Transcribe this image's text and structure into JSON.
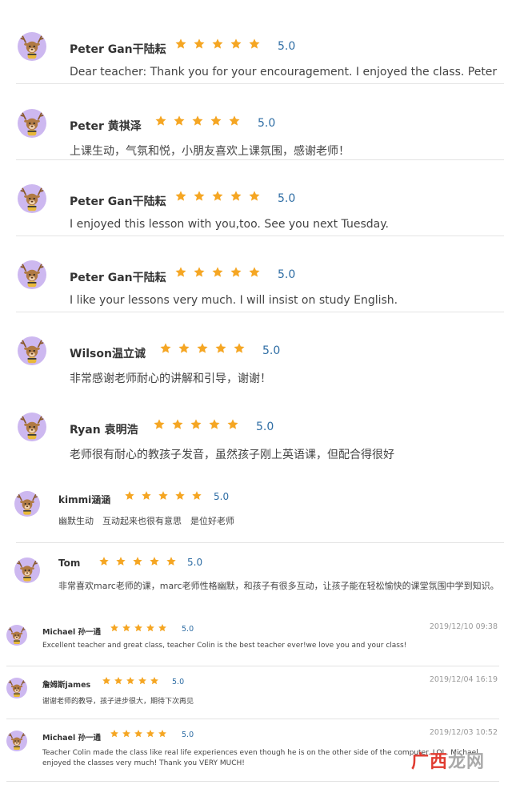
{
  "reviews": [
    {
      "name": "Peter Gan干陆耘",
      "score": "5.0",
      "rating": 5,
      "text": "Dear teacher: Thank you for your encouragement. I enjoyed the class. Peter"
    },
    {
      "name": "Peter 黄祺泽",
      "score": "5.0",
      "rating": 5,
      "text": "上课生动，气氛和悦，小朋友喜欢上课氛围，感谢老师！"
    },
    {
      "name": "Peter Gan干陆耘",
      "score": "5.0",
      "rating": 5,
      "text": "I enjoyed this lesson with you,too. See you next Tuesday."
    },
    {
      "name": "Peter Gan干陆耘",
      "score": "5.0",
      "rating": 5,
      "text": "I like your lessons very much. I will insist on study English."
    },
    {
      "name": "Wilson温立诚",
      "score": "5.0",
      "rating": 5,
      "text": "非常感谢老师耐心的讲解和引导，谢谢！"
    },
    {
      "name": "Ryan 袁明浩",
      "score": "5.0",
      "rating": 5,
      "text": "老师很有耐心的教孩子发音，虽然孩子刚上英语课，但配合得很好"
    },
    {
      "name": "kimmi涵涵",
      "score": "5.0",
      "rating": 5,
      "text": "幽默生动　互动起来也很有意思　是位好老师"
    },
    {
      "name": "Tom",
      "score": "5.0",
      "rating": 5,
      "text": "非常喜欢marc老师的课，marc老师性格幽默，和孩子有很多互动，让孩子能在轻松愉快的课堂氛围中学到知识。"
    },
    {
      "name": "Michael 孙一通",
      "score": "5.0",
      "rating": 5,
      "date": "2019/12/10 09:38",
      "text": "Excellent teacher and great class, teacher Colin is the best teacher ever!we love you and your class!"
    },
    {
      "name": "詹姆斯james",
      "score": "5.0",
      "rating": 5,
      "date": "2019/12/04 16:19",
      "text": "谢谢老师的教导，孩子进步很大，期待下次再见"
    },
    {
      "name": "Michael 孙一通",
      "score": "5.0",
      "rating": 5,
      "date": "2019/12/03 10:52",
      "text": "Teacher Colin made the class like real life experiences even though he is on the other side of the computer. LOL. Michael enjoyed the classes very much! Thank you VERY MUCH!"
    }
  ],
  "colors": {
    "star": "#f5a623",
    "score": "#2e6da4",
    "avatar_bg": "#cdb8f0"
  },
  "icons": {
    "avatar": "reindeer-avatar-icon",
    "star": "star-icon"
  },
  "watermark": {
    "prefix": "广西",
    "suffix": "龙网"
  }
}
